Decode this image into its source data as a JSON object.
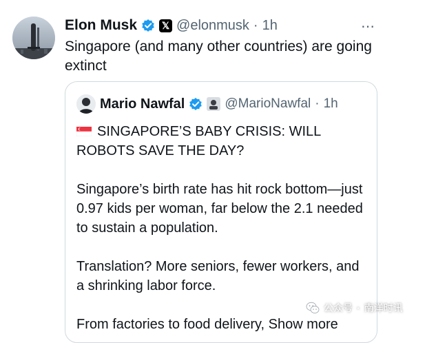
{
  "tweet": {
    "author_name": "Elon Musk",
    "handle": "@elonmusk",
    "time_sep": "·",
    "time": "1h",
    "badge_x_label": "𝕏",
    "more_icon": "⋯",
    "text": "Singapore (and many other countries) are going extinct"
  },
  "quote": {
    "author_name": "Mario Nawfal",
    "handle": "@MarioNawfal",
    "time_sep": "·",
    "time": "1h",
    "headline": "SINGAPORE’S BABY CRISIS: WILL ROBOTS SAVE THE DAY?",
    "para1": "Singapore’s birth rate has hit rock bottom—just 0.97 kids per woman, far below the 2.1 needed to sustain a population.",
    "para2": "Translation? More seniors, fewer workers, and a shrinking labor force.",
    "para3_prefix": "From factories to food delivery,",
    "show_more": "Show more"
  },
  "watermark": {
    "prefix": "公众号",
    "dot": "·",
    "name": "南洋时讯"
  },
  "colors": {
    "verified_blue": "#1d9bf0",
    "muted_text": "#536471",
    "border": "#cfd9de",
    "flag_red": "#ef3340"
  }
}
